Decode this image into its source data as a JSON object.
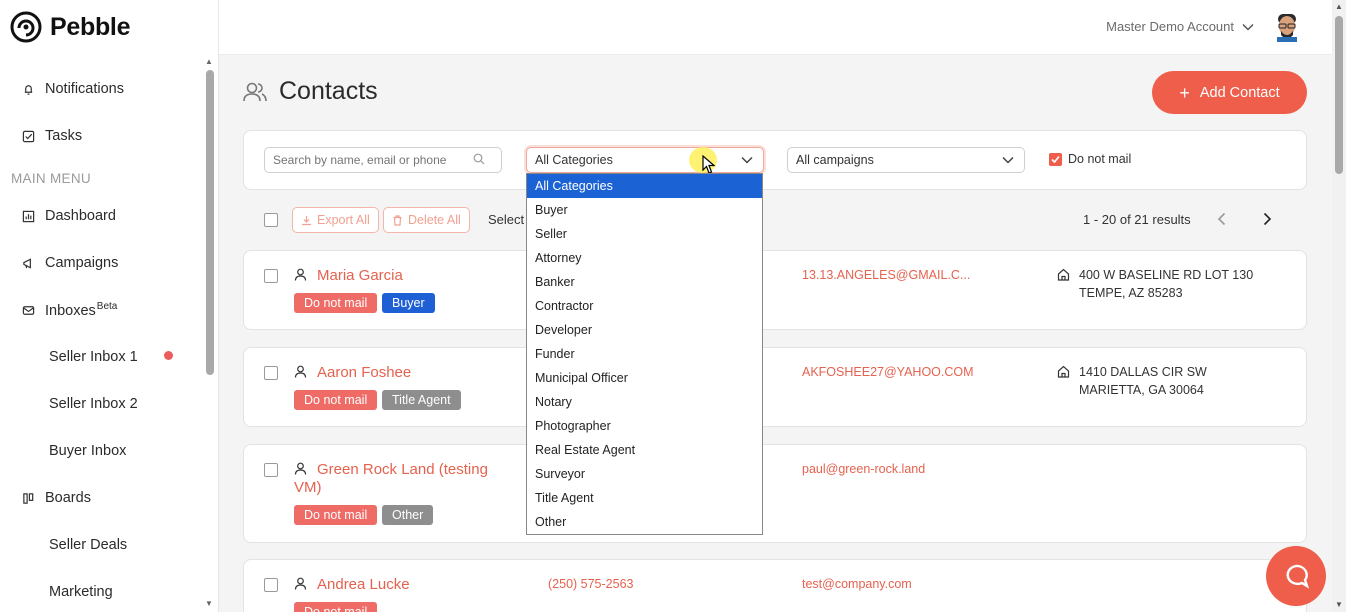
{
  "app": {
    "name": "Pebble"
  },
  "account": {
    "label": "Master Demo Account"
  },
  "sidebar": {
    "top_items": [
      {
        "label": "Notifications",
        "icon": "bell-icon"
      },
      {
        "label": "Tasks",
        "icon": "checkbox-icon"
      }
    ],
    "section_label": "MAIN MENU",
    "menu": [
      {
        "label": "Dashboard",
        "icon": "dashboard-icon"
      },
      {
        "label": "Campaigns",
        "icon": "megaphone-icon"
      },
      {
        "label": "Inboxes",
        "badge": "Beta",
        "icon": "mail-icon"
      },
      {
        "label": "Seller Inbox 1",
        "sub": true,
        "unread_dot": true
      },
      {
        "label": "Seller Inbox 2",
        "sub": true
      },
      {
        "label": "Buyer Inbox",
        "sub": true
      },
      {
        "label": "Boards",
        "icon": "board-icon"
      },
      {
        "label": "Seller Deals",
        "sub": true
      },
      {
        "label": "Marketing",
        "sub": true
      }
    ]
  },
  "page": {
    "title": "Contacts",
    "add_button": "Add Contact"
  },
  "filters": {
    "search_placeholder": "Search by name, email or phone",
    "category_selected": "All Categories",
    "campaign_selected": "All campaigns",
    "do_not_mail_label": "Do not mail",
    "do_not_mail_checked": true
  },
  "category_options": [
    "All Categories",
    "Buyer",
    "Seller",
    "Attorney",
    "Banker",
    "Contractor",
    "Developer",
    "Funder",
    "Municipal Officer",
    "Notary",
    "Photographer",
    "Real Estate Agent",
    "Surveyor",
    "Title Agent",
    "Other"
  ],
  "toolbar": {
    "export_label": "Export All",
    "delete_label": "Delete All",
    "select_label": "Select",
    "results_label": "1 - 20 of 21 results",
    "prev": "‹",
    "next": "›"
  },
  "contacts": [
    {
      "name": "Maria Garcia",
      "tags": [
        "Do not mail",
        "Buyer"
      ],
      "email": "13.13.ANGELES@GMAIL.C...",
      "address_line1": "400 W BASELINE RD LOT 130",
      "address_line2": "TEMPE, AZ 85283"
    },
    {
      "name": "Aaron Foshee",
      "tags": [
        "Do not mail",
        "Title Agent"
      ],
      "email": "AKFOSHEE27@YAHOO.COM",
      "address_line1": "1410 DALLAS CIR SW",
      "address_line2": "MARIETTA, GA 30064"
    },
    {
      "name_line1": "Green Rock Land (testing",
      "name_line2": "VM)",
      "tags": [
        "Do not mail",
        "Other"
      ],
      "email": "paul@green-rock.land"
    },
    {
      "name": "Andrea Lucke",
      "phone": "(250) 575-2563",
      "email": "test@company.com",
      "tags": [
        "Do not mail"
      ]
    }
  ],
  "colors": {
    "accent": "#ee5e4a",
    "link": "#e5624f",
    "tag_red": "#ee6b66",
    "tag_blue": "#1f5fd6",
    "tag_gray": "#8e8e8e",
    "dropdown_selected": "#1b62d4"
  }
}
